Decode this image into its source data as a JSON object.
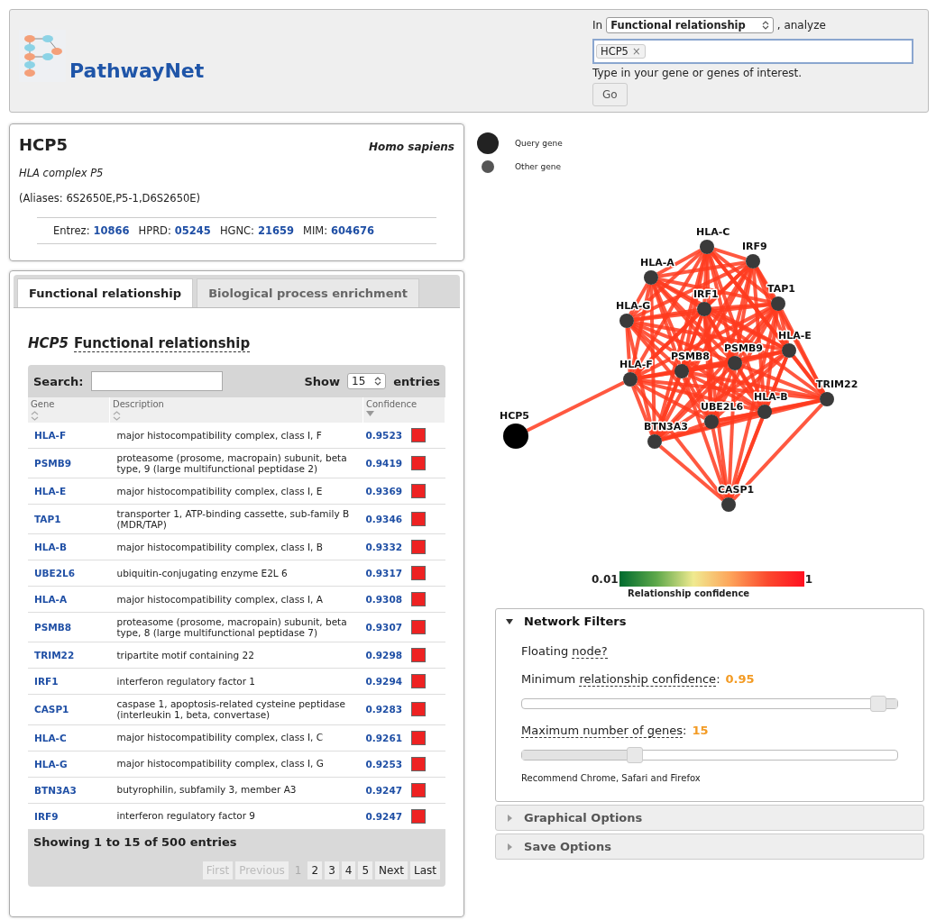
{
  "header": {
    "brand": "PathwayNet",
    "mode_prefix": "In",
    "mode_select": "Functional relationship",
    "mode_suffix": ", analyze",
    "tokens": [
      "HCP5"
    ],
    "token_remove": "×",
    "hint": "Type in your gene or genes of interest.",
    "go_button": "Go"
  },
  "gene_card": {
    "symbol": "HCP5",
    "species": "Homo sapiens",
    "full_name": "HLA complex P5",
    "aliases": "(Aliases: 6S2650E,P5-1,D6S2650E)",
    "ids": [
      {
        "label": "Entrez:",
        "value": "10866"
      },
      {
        "label": "HPRD:",
        "value": "05245"
      },
      {
        "label": "HGNC:",
        "value": "21659"
      },
      {
        "label": "MIM:",
        "value": "604676"
      }
    ]
  },
  "tabs": [
    {
      "label": "Functional relationship",
      "selected": true
    },
    {
      "label": "Biological process enrichment",
      "selected": false
    }
  ],
  "section_title": {
    "gene": "HCP5",
    "title": "Functional relationship"
  },
  "table": {
    "search_label": "Search:",
    "show_label": "Show",
    "page_size": "15",
    "entries_label": "entries",
    "columns": [
      {
        "label": "Gene",
        "sorted_descending": false
      },
      {
        "label": "Description",
        "sorted_descending": false
      },
      {
        "label": "Confidence",
        "sorted_descending": true
      }
    ],
    "rows": [
      {
        "gene": "HLA-F",
        "description": "major histocompatibility complex, class I, F",
        "confidence": "0.9523"
      },
      {
        "gene": "PSMB9",
        "description": "proteasome (prosome, macropain) subunit, beta type, 9 (large multifunctional peptidase 2)",
        "confidence": "0.9419"
      },
      {
        "gene": "HLA-E",
        "description": "major histocompatibility complex, class I, E",
        "confidence": "0.9369"
      },
      {
        "gene": "TAP1",
        "description": "transporter 1, ATP-binding cassette, sub-family B (MDR/TAP)",
        "confidence": "0.9346"
      },
      {
        "gene": "HLA-B",
        "description": "major histocompatibility complex, class I, B",
        "confidence": "0.9332"
      },
      {
        "gene": "UBE2L6",
        "description": "ubiquitin-conjugating enzyme E2L 6",
        "confidence": "0.9317"
      },
      {
        "gene": "HLA-A",
        "description": "major histocompatibility complex, class I, A",
        "confidence": "0.9308"
      },
      {
        "gene": "PSMB8",
        "description": "proteasome (prosome, macropain) subunit, beta type, 8 (large multifunctional peptidase 7)",
        "confidence": "0.9307"
      },
      {
        "gene": "TRIM22",
        "description": "tripartite motif containing 22",
        "confidence": "0.9298"
      },
      {
        "gene": "IRF1",
        "description": "interferon regulatory factor 1",
        "confidence": "0.9294"
      },
      {
        "gene": "CASP1",
        "description": "caspase 1, apoptosis-related cysteine peptidase (interleukin 1, beta, convertase)",
        "confidence": "0.9283"
      },
      {
        "gene": "HLA-C",
        "description": "major histocompatibility complex, class I, C",
        "confidence": "0.9261"
      },
      {
        "gene": "HLA-G",
        "description": "major histocompatibility complex, class I, G",
        "confidence": "0.9253"
      },
      {
        "gene": "BTN3A3",
        "description": "butyrophilin, subfamily 3, member A3",
        "confidence": "0.9247"
      },
      {
        "gene": "IRF9",
        "description": "interferon regulatory factor 9",
        "confidence": "0.9247"
      }
    ],
    "info": "Showing 1 to 15 of 500 entries",
    "pages": [
      {
        "label": "First",
        "disabled": true,
        "selected": false
      },
      {
        "label": "Previous",
        "disabled": true,
        "selected": false
      },
      {
        "label": "1",
        "disabled": false,
        "selected": true
      },
      {
        "label": "2",
        "disabled": false,
        "selected": false
      },
      {
        "label": "3",
        "disabled": false,
        "selected": false
      },
      {
        "label": "4",
        "disabled": false,
        "selected": false
      },
      {
        "label": "5",
        "disabled": false,
        "selected": false
      },
      {
        "label": "Next",
        "disabled": false,
        "selected": false
      },
      {
        "label": "Last",
        "disabled": false,
        "selected": false
      }
    ]
  },
  "legend": [
    {
      "kind": "query",
      "label": "Query gene"
    },
    {
      "kind": "other",
      "label": "Other gene"
    }
  ],
  "network": {
    "nodes": [
      {
        "label": "HLA-C",
        "kind": "other"
      },
      {
        "label": "IRF9",
        "kind": "other"
      },
      {
        "label": "HLA-A",
        "kind": "other"
      },
      {
        "label": "TAP1",
        "kind": "other"
      },
      {
        "label": "IRF1",
        "kind": "other"
      },
      {
        "label": "HLA-G",
        "kind": "other"
      },
      {
        "label": "HLA-E",
        "kind": "other"
      },
      {
        "label": "PSMB9",
        "kind": "other"
      },
      {
        "label": "PSMB8",
        "kind": "other"
      },
      {
        "label": "HLA-F",
        "kind": "other"
      },
      {
        "label": "TRIM22",
        "kind": "other"
      },
      {
        "label": "HLA-B",
        "kind": "other"
      },
      {
        "label": "UBE2L6",
        "kind": "other"
      },
      {
        "label": "HCP5",
        "kind": "query"
      },
      {
        "label": "BTN3A3",
        "kind": "other"
      },
      {
        "label": "CASP1",
        "kind": "other"
      }
    ]
  },
  "color_scale": {
    "min": "0.01",
    "max": "1",
    "title": "Relationship confidence"
  },
  "panels": [
    {
      "title": "Network Filters",
      "expanded": true,
      "filters": [
        {
          "kind": "label",
          "prefix": "Floating",
          "term": "node?"
        },
        {
          "kind": "slider",
          "prefix": "Minimum",
          "term": "relationship confidence",
          "suffix": ":",
          "value": "0.95",
          "level": 0.95,
          "range_after_thumb": true
        },
        {
          "kind": "slider",
          "term": "Maximum number of genes",
          "suffix": ":",
          "value": "15",
          "level": 0.3,
          "range_after_thumb": false
        }
      ],
      "note": "Recommend Chrome, Safari and Firefox"
    },
    {
      "title": "Graphical Options",
      "expanded": false
    },
    {
      "title": "Save Options",
      "expanded": false
    }
  ]
}
